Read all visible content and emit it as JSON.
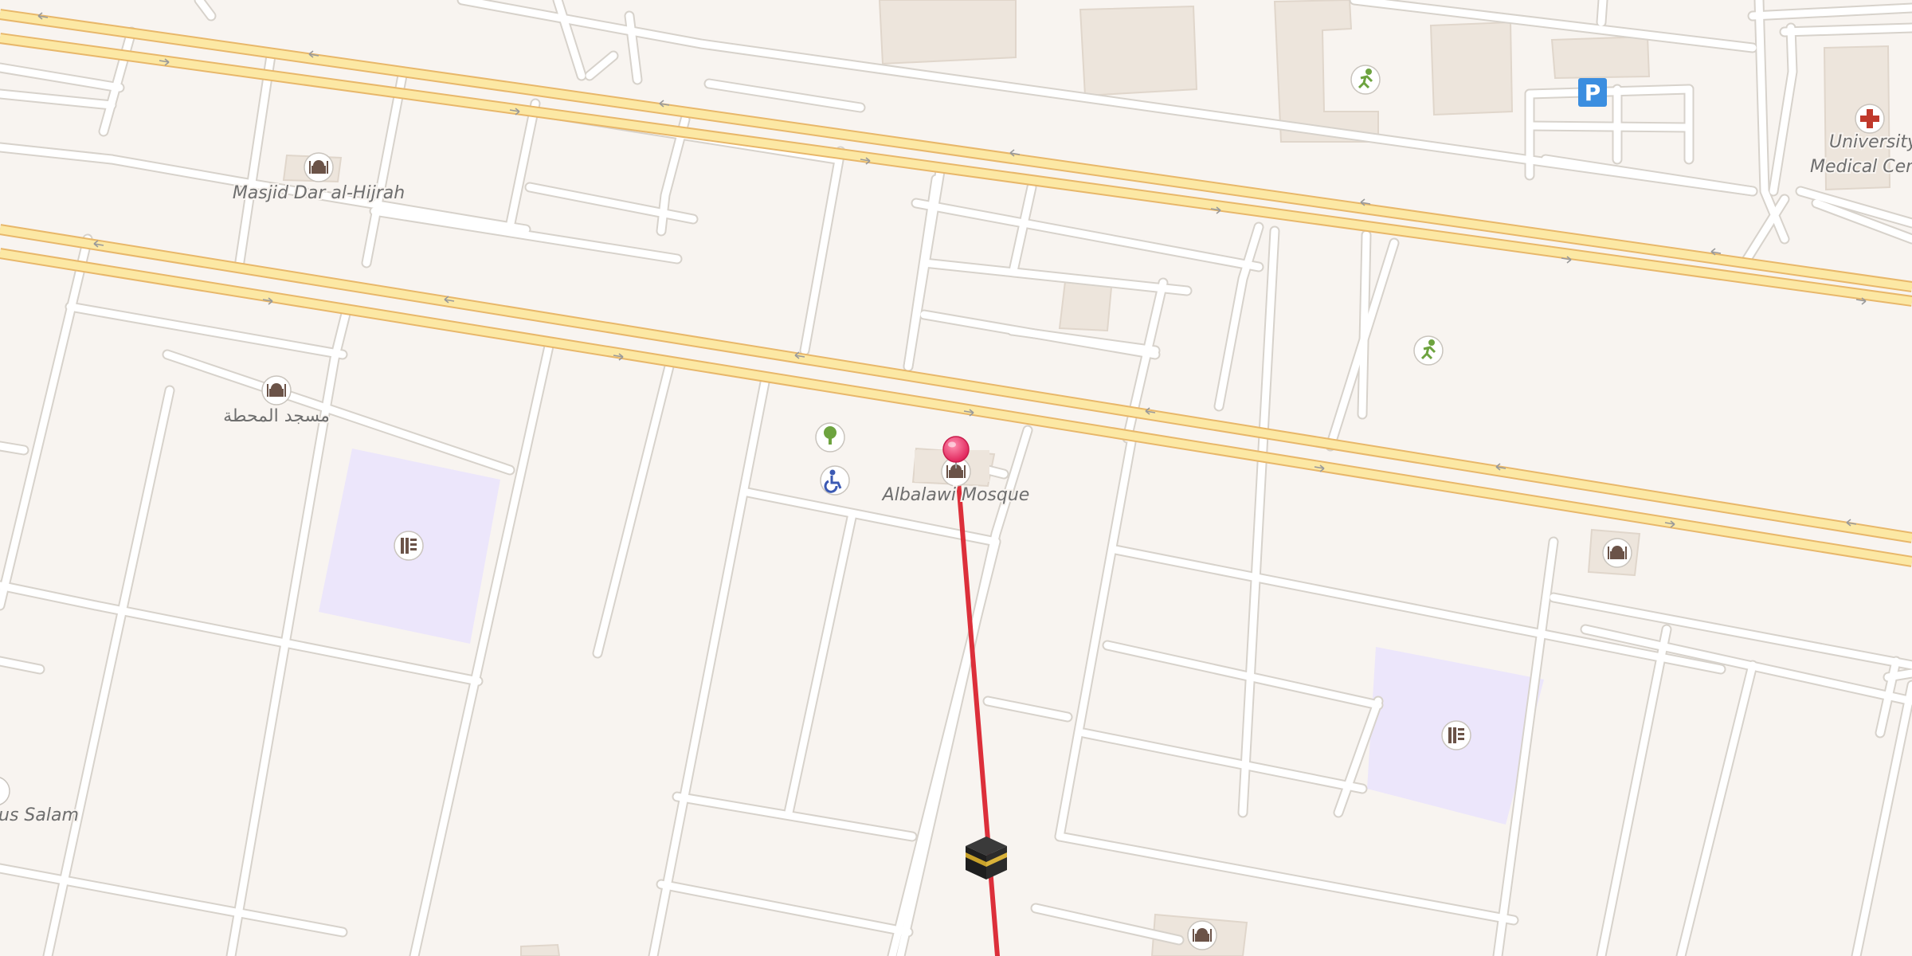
{
  "map": {
    "labels": {
      "masjid_dar_al_hijrah": "Masjid Dar al-Hijrah",
      "masjid_arabic": "مسجد المحطة",
      "albalawi_mosque": "Albalawi Mosque",
      "university_medical": "University",
      "university_medical_2": "Medical Cent",
      "dus_salam": "us Salam"
    },
    "parking_symbol": "P",
    "icons": {
      "mosque": "mosque-icon",
      "school": "school-icon",
      "park": "tree-icon",
      "sport": "running-icon",
      "hospital": "hospital-cross-icon",
      "parking": "parking-icon",
      "disabled": "wheelchair-icon",
      "kaaba": "kaaba-icon",
      "pin": "location-pin-icon"
    },
    "colors": {
      "background": "#f8f4f0",
      "road_minor": "#ffffff",
      "road_casing": "#d7d2cb",
      "road_major_fill": "#fce8a4",
      "road_major_casing": "#e8b76a",
      "building": "#ede5dc",
      "school_area": "#ece6fb",
      "qibla_line": "#dc2f3a",
      "pin": "#e8355f",
      "mosque_icon": "#6b5348",
      "park_icon": "#6da33f",
      "hospital_icon": "#c0392b",
      "parking_bg": "#3b8ee0",
      "wheelchair_icon": "#3b59b3"
    }
  }
}
